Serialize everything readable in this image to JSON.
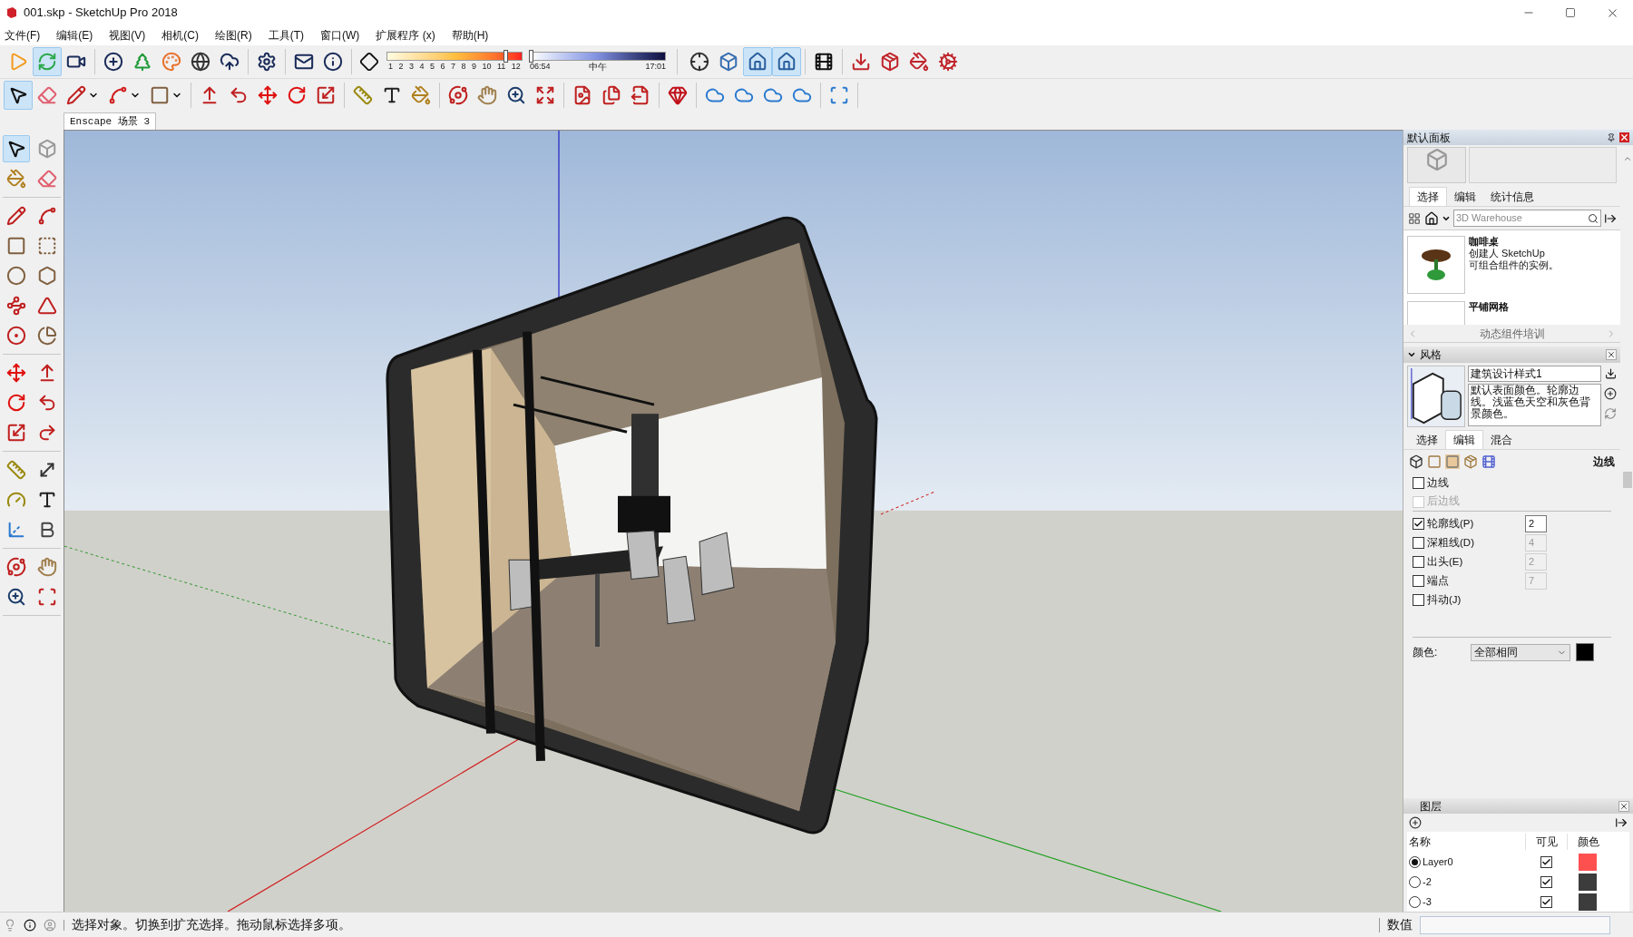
{
  "window": {
    "title": "001.skp - SketchUp Pro 2018"
  },
  "menu": [
    "文件(F)",
    "编辑(E)",
    "视图(V)",
    "相机(C)",
    "绘图(R)",
    "工具(T)",
    "窗口(W)",
    "扩展程序 (x)",
    "帮助(H)"
  ],
  "toolbar_top": {
    "buttons_left": [
      {
        "selected": false
      },
      {
        "selected": true
      },
      {
        "selected": false
      },
      {
        "selected": false
      },
      {
        "selected": false
      },
      {
        "selected": false
      },
      {
        "selected": false
      },
      {
        "selected": false
      },
      {
        "selected": false
      },
      {
        "selected": false
      },
      {
        "selected": false
      }
    ],
    "month_slider": {
      "labels": [
        "1",
        "2",
        "3",
        "4",
        "5",
        "6",
        "7",
        "8",
        "9",
        "10",
        "11",
        "12"
      ],
      "level": 0.88
    },
    "time_slider": {
      "start": "06:54",
      "middle": "中午",
      "end": "17:01",
      "level": 0.0
    },
    "buttons_right": [
      {
        "selected": false
      },
      {
        "selected": false
      },
      {
        "selected": true
      },
      {
        "selected": true
      },
      {
        "selected": false
      },
      {
        "selected": false
      },
      {
        "selected": false
      },
      {
        "selected": false
      },
      {
        "selected": false
      }
    ]
  },
  "toolbar_second": {
    "buttons": [
      {
        "selected": true
      },
      {
        "selected": false
      },
      {
        "selected": false
      },
      {
        "selected": false
      },
      {
        "selected": false
      },
      {
        "selected": false
      },
      {
        "selected": false
      },
      {
        "selected": false
      },
      {
        "selected": false
      },
      {
        "selected": false
      },
      {
        "selected": false
      },
      {
        "selected": false
      },
      {
        "selected": false
      },
      {
        "selected": false
      },
      {
        "selected": false
      },
      {
        "selected": false
      },
      {
        "selected": false
      },
      {
        "selected": false
      },
      {
        "selected": false
      },
      {
        "selected": false
      },
      {
        "selected": false
      },
      {
        "selected": false
      },
      {
        "selected": false
      },
      {
        "selected": false
      },
      {
        "selected": false
      },
      {
        "selected": false
      }
    ]
  },
  "scene_tabs": [
    {
      "label": "Enscape 场景 3",
      "selected": true
    }
  ],
  "left_toolbar": {
    "buttons": [
      {
        "selected": true
      },
      {
        "selected": false
      },
      {
        "selected": false
      },
      {
        "selected": false
      },
      {
        "selected": false
      },
      {
        "selected": false
      },
      {
        "selected": false
      },
      {
        "selected": false
      },
      {
        "selected": false
      },
      {
        "selected": false
      },
      {
        "selected": false
      },
      {
        "selected": false
      },
      {
        "selected": false
      },
      {
        "selected": false
      },
      {
        "selected": false
      },
      {
        "selected": false
      },
      {
        "selected": false
      },
      {
        "selected": false
      },
      {
        "selected": false
      },
      {
        "selected": false
      },
      {
        "selected": false
      },
      {
        "selected": false
      },
      {
        "selected": false
      },
      {
        "selected": false
      },
      {
        "selected": false
      },
      {
        "selected": false
      },
      {
        "selected": false
      },
      {
        "selected": false
      },
      {
        "selected": false
      },
      {
        "selected": false
      }
    ]
  },
  "tray": {
    "title": "默认面板",
    "components": {
      "tabs": [
        {
          "label": "选择",
          "selected": true
        },
        {
          "label": "编辑",
          "selected": false
        },
        {
          "label": "统计信息",
          "selected": false
        }
      ],
      "search": {
        "placeholder": "3D Warehouse"
      },
      "items": [
        {
          "title": "咖啡桌",
          "author": "创建人 SketchUp",
          "description": "可组合组件的实例。"
        },
        {
          "title": "平铺网格"
        }
      ],
      "collection": "动态组件培训"
    },
    "styles": {
      "title": "风格",
      "expanded": true,
      "name": "建筑设计样式1",
      "description": "默认表面颜色。轮廓边线。浅蓝色天空和灰色背景颜色。",
      "tabs": [
        {
          "label": "选择",
          "selected": false
        },
        {
          "label": "编辑",
          "selected": true
        },
        {
          "label": "混合",
          "selected": false
        }
      ],
      "section_label": "边线",
      "options": [
        {
          "label": "边线",
          "checked": false,
          "disabled": false
        },
        {
          "label": "后边线",
          "checked": false,
          "disabled": true
        },
        {
          "label": "轮廓线(P)",
          "checked": true,
          "disabled": false,
          "value": "2"
        },
        {
          "label": "深粗线(D)",
          "checked": false,
          "disabled": false,
          "value": "4"
        },
        {
          "label": "出头(E)",
          "checked": false,
          "disabled": false,
          "value": "2"
        },
        {
          "label": "端点",
          "checked": false,
          "disabled": false,
          "value": "7"
        },
        {
          "label": "抖动(J)",
          "checked": false,
          "disabled": false
        }
      ],
      "color_label": "颜色:",
      "color_mode": "全部相同"
    },
    "layers": {
      "title": "图层",
      "columns": [
        "名称",
        "可见",
        "颜色"
      ],
      "rows": [
        {
          "name": "Layer0",
          "selected": true,
          "visible": true,
          "color": "#ff5050"
        },
        {
          "name": "-2",
          "selected": false,
          "visible": true,
          "color": "#3c3c3c"
        },
        {
          "name": "-3",
          "selected": false,
          "visible": true,
          "color": "#3c3c3c"
        }
      ]
    }
  },
  "status_bar": {
    "message": "选择对象。切换到扩充选择。拖动鼠标选择多项。",
    "measurements_label": "数值"
  }
}
